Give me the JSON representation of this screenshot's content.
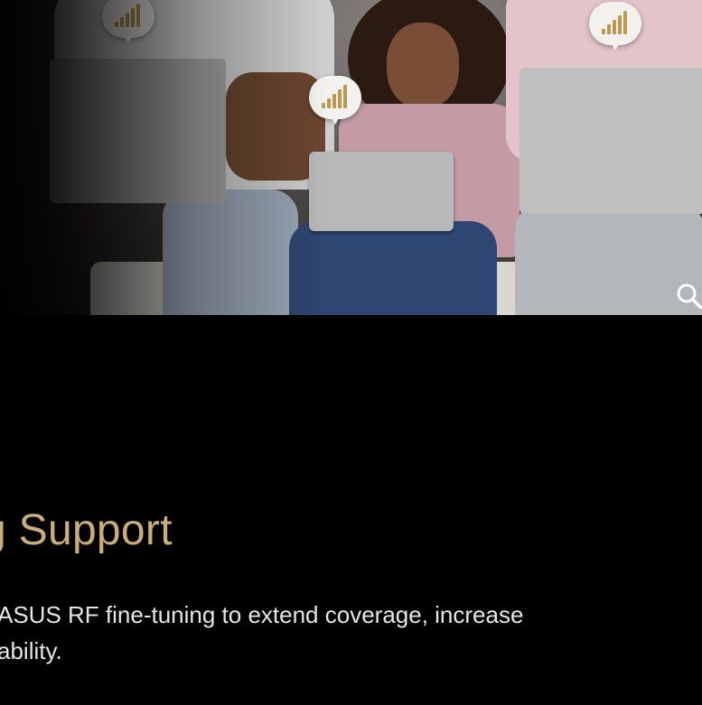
{
  "hero": {
    "pins": [
      {
        "icon": "wifi-signal-icon"
      },
      {
        "icon": "wifi-signal-icon"
      },
      {
        "icon": "wifi-signal-icon"
      }
    ],
    "zoom_icon": "search-icon"
  },
  "section": {
    "heading": "g Support",
    "description_lines": [
      "ASUS RF fine-tuning to extend coverage, increase",
      "ability."
    ]
  },
  "colors": {
    "background": "#000000",
    "heading": "#c9ad7a",
    "body_text": "#e6e6e6",
    "signal_bars": "#b99a52",
    "pin_bubble": "#f3f1ee"
  }
}
